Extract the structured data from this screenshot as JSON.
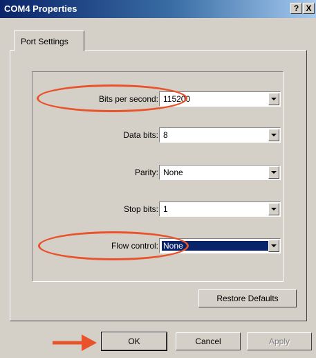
{
  "window": {
    "title": "COM4 Properties",
    "help_label": "?",
    "close_label": "X"
  },
  "tabs": [
    {
      "label": "Port Settings"
    }
  ],
  "settings": [
    {
      "label": "Bits per second:",
      "value": "115200"
    },
    {
      "label": "Data bits:",
      "value": "8"
    },
    {
      "label": "Parity:",
      "value": "None"
    },
    {
      "label": "Stop bits:",
      "value": "1"
    },
    {
      "label": "Flow control:",
      "value": "None"
    }
  ],
  "restore_label": "Restore Defaults",
  "footer": {
    "ok_label": "OK",
    "cancel_label": "Cancel",
    "apply_label": "Apply"
  },
  "annotations": {
    "highlight_color": "#e8532b"
  }
}
